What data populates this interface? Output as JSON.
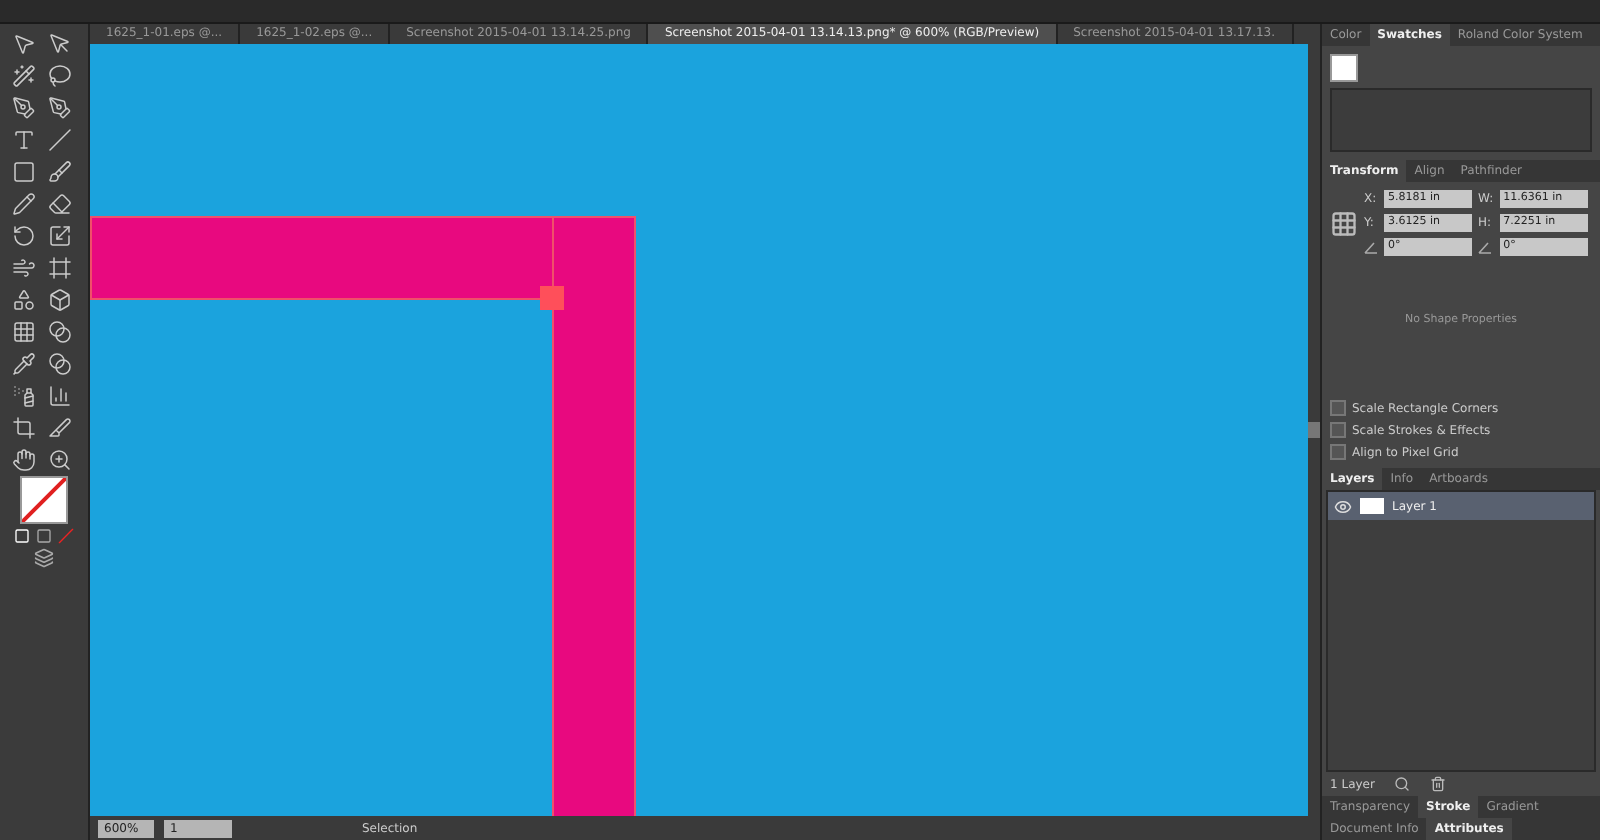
{
  "tabs": [
    {
      "label": "1625_1-01.eps @...",
      "selected": false
    },
    {
      "label": "1625_1-02.eps @...",
      "selected": false
    },
    {
      "label": "Screenshot 2015-04-01 13.14.25.png",
      "selected": false
    },
    {
      "label": "Screenshot 2015-04-01 13.14.13.png* @ 600% (RGB/Preview)",
      "selected": true
    },
    {
      "label": "Screenshot 2015-04-01 13.17.13.",
      "selected": false
    }
  ],
  "swatches_panel": {
    "tabs": [
      {
        "label": "Color",
        "selected": false
      },
      {
        "label": "Swatches",
        "selected": true
      },
      {
        "label": "Roland Color System",
        "selected": false
      }
    ]
  },
  "transform_panel": {
    "tabs": [
      {
        "label": "Transform",
        "selected": true
      },
      {
        "label": "Align",
        "selected": false
      },
      {
        "label": "Pathfinder",
        "selected": false
      }
    ],
    "fields": [
      {
        "label": "X:",
        "value": "5.8181 in"
      },
      {
        "label": "W:",
        "value": "11.6361 in"
      },
      {
        "label": "Y:",
        "value": "3.6125 in"
      },
      {
        "label": "H:",
        "value": "7.2251 in"
      }
    ],
    "angles": [
      {
        "value": "0°"
      },
      {
        "value": "0°"
      }
    ],
    "message": "No Shape Properties",
    "options": [
      {
        "label": "Scale Rectangle Corners",
        "checked": false
      },
      {
        "label": "Scale Strokes & Effects",
        "checked": false
      },
      {
        "label": "Align to Pixel Grid",
        "checked": false
      }
    ]
  },
  "layers_panel": {
    "tabs": [
      {
        "label": "Layers",
        "selected": true
      },
      {
        "label": "Info",
        "selected": false
      },
      {
        "label": "Artboards",
        "selected": false
      }
    ],
    "layers": [
      {
        "name": "Layer 1",
        "visible": true
      }
    ],
    "footer": "1 Layer"
  },
  "bottom_panels": [
    {
      "tabs": [
        {
          "label": "Transparency",
          "selected": false
        },
        {
          "label": "Stroke",
          "selected": true
        },
        {
          "label": "Gradient",
          "selected": false
        }
      ]
    },
    {
      "tabs": [
        {
          "label": "Document Info",
          "selected": false
        },
        {
          "label": "Attributes",
          "selected": true
        }
      ]
    }
  ],
  "status_bar": {
    "zoom": "600%",
    "artboard": "1",
    "tool": "Selection"
  }
}
